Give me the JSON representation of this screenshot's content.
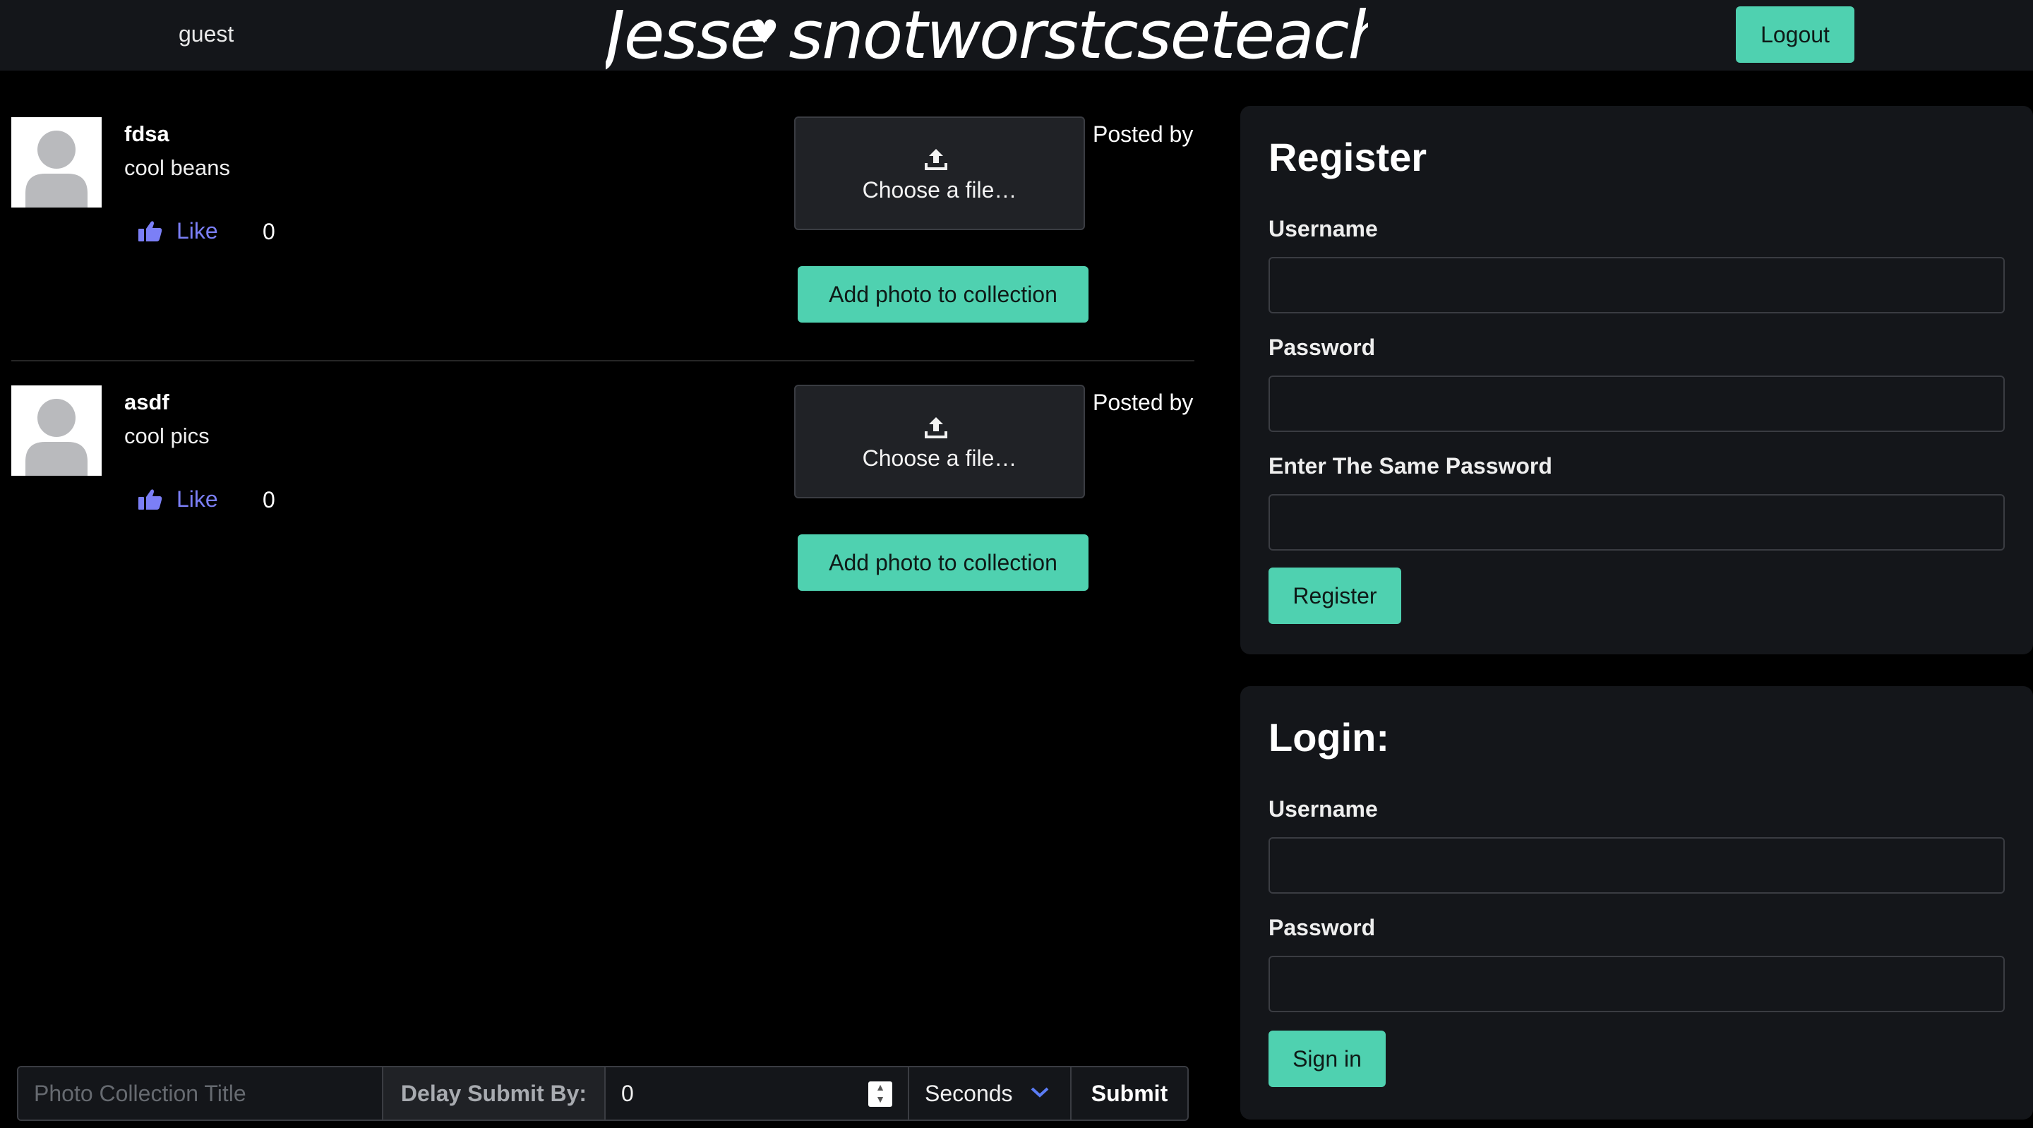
{
  "header": {
    "username": "guest",
    "brand": "Jesse snotworstcseteacher",
    "logout_label": "Logout"
  },
  "posts": [
    {
      "name": "fdsa",
      "description": "cool beans",
      "like_label": "Like",
      "like_count": "0",
      "file_label": "Choose a file…",
      "add_photo_label": "Add photo to collection",
      "posted_by": "Posted by"
    },
    {
      "name": "asdf",
      "description": "cool pics",
      "like_label": "Like",
      "like_count": "0",
      "file_label": "Choose a file…",
      "add_photo_label": "Add photo to collection",
      "posted_by": "Posted by"
    }
  ],
  "collection_form": {
    "title_placeholder": "Photo Collection Title",
    "delay_label": "Delay Submit By:",
    "delay_value": "0",
    "unit_selected": "Seconds",
    "submit_label": "Submit"
  },
  "register": {
    "title": "Register",
    "username_label": "Username",
    "password_label": "Password",
    "confirm_label": "Enter The Same Password",
    "button_label": "Register"
  },
  "login": {
    "title": "Login:",
    "username_label": "Username",
    "password_label": "Password",
    "button_label": "Sign in"
  },
  "colors": {
    "accent": "#4fd1b0",
    "like": "#7b7ff6",
    "panel_bg": "#14161a"
  },
  "icons": [
    "thumbs-up-icon",
    "upload-icon",
    "chevron-down-icon",
    "avatar-placeholder-icon",
    "heart-icon"
  ]
}
